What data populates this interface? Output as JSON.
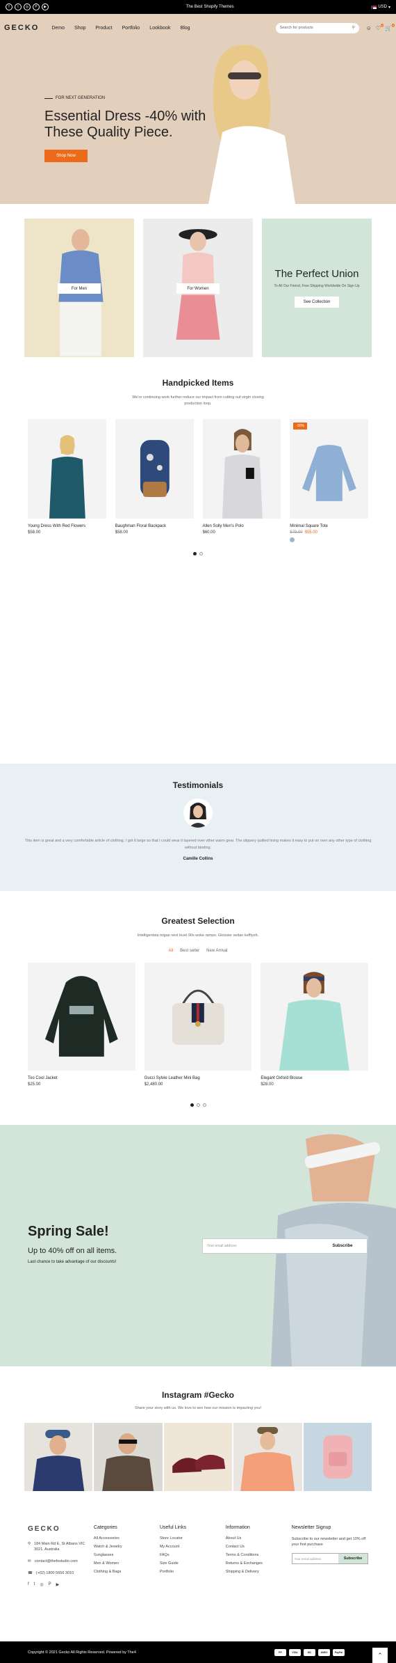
{
  "topbar": {
    "announcement": "The Best Shopify Themes",
    "currency": "USD",
    "flag_icon": "us-flag-icon",
    "socials": [
      "f",
      "t",
      "◎",
      "P",
      "▶"
    ]
  },
  "header": {
    "logo": "GECKO",
    "nav": [
      "Demo",
      "Shop",
      "Product",
      "Portfolio",
      "Lookbook",
      "Blog"
    ],
    "search_placeholder": "Search for products",
    "wishlist_count": "0",
    "cart_count": "0"
  },
  "hero": {
    "kicker": "FOR NEXT GENERATION",
    "title": "Essential Dress -40% with These Quality Piece.",
    "button": "Shop Now"
  },
  "collections": {
    "men": "For Men",
    "women": "For Women",
    "union_title": "The Perfect Union",
    "union_sub": "To All Our Friend, Free Shipping Worldwide On Sign Up",
    "union_button": "See Collection"
  },
  "handpicked": {
    "title": "Handpicked Items",
    "subtitle": "We're continuing work further reduce our impact from cutting out virgin closing production loop.",
    "products": [
      {
        "name": "Young Dress With Red Flowers",
        "price": "$58.00"
      },
      {
        "name": "Baughman Floral Backpack",
        "price": "$58.00"
      },
      {
        "name": "Allen Solly Men's Polo",
        "price": "$60.00"
      },
      {
        "name": "Minimal Square Tote",
        "old_price": "$79.00",
        "price": "$55.00",
        "badge": "-30%"
      }
    ]
  },
  "testimonials": {
    "title": "Testimonials",
    "quote": "This item is great and a very comfortable article of clothing. I got it large so that I could wear it layered over other warm gear. The slippery quilted lining makes it easy to put on over any other type of clothing without binding.",
    "author": "Camille Collins"
  },
  "greatest": {
    "title": "Greatest Selection",
    "subtitle": "Intelligentsia migas next level 90s woke ramps. Glossier seitan keffiyeh.",
    "tabs": [
      "All",
      "Best seller",
      "New Arrival"
    ],
    "products": [
      {
        "name": "Too Cool Jacket",
        "price": "$25.00"
      },
      {
        "name": "Gucci Sylvie Leather Mini Bag",
        "price": "$2,480.00"
      },
      {
        "name": "Elegant Oxford Blouse",
        "price": "$28.00"
      }
    ]
  },
  "spring_sale": {
    "title": "Spring Sale!",
    "subtitle": "Up to 40% off on all items.",
    "note": "Last chance to take advantage of our discounts!",
    "placeholder": "Your email address",
    "button": "Subscribe"
  },
  "instagram": {
    "title": "Instagram #Gecko",
    "subtitle": "Share your story with us. We love to see how our mission is impacting you!"
  },
  "footer": {
    "logo": "GECKO",
    "address": "184 Main Rd E, St Albans VIC 3021, Australia",
    "email": "contact@thefostudio.com",
    "phone": "(+02) 1800 5656 3010",
    "categories_title": "Categories",
    "categories": [
      "All Accessories",
      "Watch & Jewelry",
      "Sunglasses",
      "Men & Women",
      "Clothing & Bags"
    ],
    "useful_title": "Useful Links",
    "useful": [
      "Store Locator",
      "My Account",
      "FAQs",
      "Size Guide",
      "Portfolio"
    ],
    "info_title": "Information",
    "info": [
      "About Us",
      "Contact Us",
      "Terms & Conditions",
      "Returns & Exchanges",
      "Shipping & Delivery"
    ],
    "newsletter_title": "Newsletter Signup",
    "newsletter_text": "Subscribe to our newsletter and get 10% off your first purchase",
    "newsletter_placeholder": "Your email address",
    "newsletter_button": "Subscribe"
  },
  "bottom": {
    "copyright": "Copyright © 2021 Gecko All Rights Reserved. Powered by The4",
    "payments": [
      "PP",
      "VISA",
      "MC",
      "AMEX",
      "PayPal"
    ]
  }
}
